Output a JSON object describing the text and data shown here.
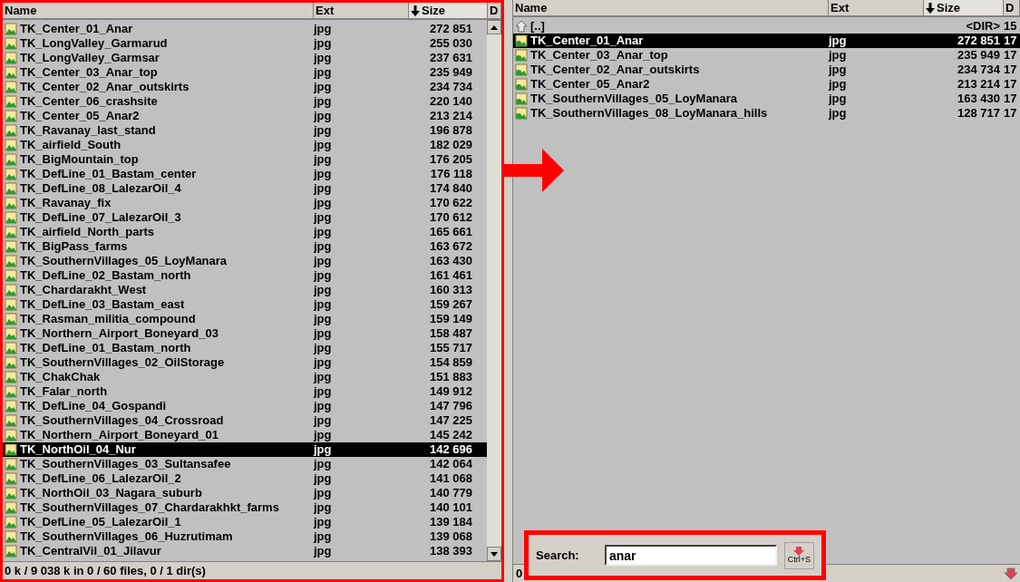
{
  "left_panel": {
    "columns": [
      {
        "label": "Name",
        "sorted": false
      },
      {
        "label": "Ext",
        "sorted": false
      },
      {
        "label": "Size",
        "sorted": true
      },
      {
        "label": "D",
        "sorted": false
      }
    ],
    "rows": [
      {
        "name": "TK_Center_01_Anar",
        "ext": "jpg",
        "size": "272 851",
        "selected": false
      },
      {
        "name": "TK_LongValley_Garmarud",
        "ext": "jpg",
        "size": "255 030",
        "selected": false
      },
      {
        "name": "TK_LongValley_Garmsar",
        "ext": "jpg",
        "size": "237 631",
        "selected": false
      },
      {
        "name": "TK_Center_03_Anar_top",
        "ext": "jpg",
        "size": "235 949",
        "selected": false
      },
      {
        "name": "TK_Center_02_Anar_outskirts",
        "ext": "jpg",
        "size": "234 734",
        "selected": false
      },
      {
        "name": "TK_Center_06_crashsite",
        "ext": "jpg",
        "size": "220 140",
        "selected": false
      },
      {
        "name": "TK_Center_05_Anar2",
        "ext": "jpg",
        "size": "213 214",
        "selected": false
      },
      {
        "name": "TK_Ravanay_last_stand",
        "ext": "jpg",
        "size": "196 878",
        "selected": false
      },
      {
        "name": "TK_airfield_South",
        "ext": "jpg",
        "size": "182 029",
        "selected": false
      },
      {
        "name": "TK_BigMountain_top",
        "ext": "jpg",
        "size": "176 205",
        "selected": false
      },
      {
        "name": "TK_DefLine_01_Bastam_center",
        "ext": "jpg",
        "size": "176 118",
        "selected": false
      },
      {
        "name": "TK_DefLine_08_LalezarOil_4",
        "ext": "jpg",
        "size": "174 840",
        "selected": false
      },
      {
        "name": "TK_Ravanay_fix",
        "ext": "jpg",
        "size": "170 622",
        "selected": false
      },
      {
        "name": "TK_DefLine_07_LalezarOil_3",
        "ext": "jpg",
        "size": "170 612",
        "selected": false
      },
      {
        "name": "TK_airfield_North_parts",
        "ext": "jpg",
        "size": "165 661",
        "selected": false
      },
      {
        "name": "TK_BigPass_farms",
        "ext": "jpg",
        "size": "163 672",
        "selected": false
      },
      {
        "name": "TK_SouthernVillages_05_LoyManara",
        "ext": "jpg",
        "size": "163 430",
        "selected": false
      },
      {
        "name": "TK_DefLine_02_Bastam_north",
        "ext": "jpg",
        "size": "161 461",
        "selected": false
      },
      {
        "name": "TK_Chardarakht_West",
        "ext": "jpg",
        "size": "160 313",
        "selected": false
      },
      {
        "name": "TK_DefLine_03_Bastam_east",
        "ext": "jpg",
        "size": "159 267",
        "selected": false
      },
      {
        "name": "TK_Rasman_militia_compound",
        "ext": "jpg",
        "size": "159 149",
        "selected": false
      },
      {
        "name": "TK_Northern_Airport_Boneyard_03",
        "ext": "jpg",
        "size": "158 487",
        "selected": false
      },
      {
        "name": "TK_DefLine_01_Bastam_north",
        "ext": "jpg",
        "size": "155 717",
        "selected": false
      },
      {
        "name": "TK_SouthernVillages_02_OilStorage",
        "ext": "jpg",
        "size": "154 859",
        "selected": false
      },
      {
        "name": "TK_ChakChak",
        "ext": "jpg",
        "size": "151 883",
        "selected": false
      },
      {
        "name": "TK_Falar_north",
        "ext": "jpg",
        "size": "149 912",
        "selected": false
      },
      {
        "name": "TK_DefLine_04_Gospandi",
        "ext": "jpg",
        "size": "147 796",
        "selected": false
      },
      {
        "name": "TK_SouthernVillages_04_Crossroad",
        "ext": "jpg",
        "size": "147 225",
        "selected": false
      },
      {
        "name": "TK_Northern_Airport_Boneyard_01",
        "ext": "jpg",
        "size": "145 242",
        "selected": false
      },
      {
        "name": "TK_NorthOil_04_Nur",
        "ext": "jpg",
        "size": "142 696",
        "selected": true
      },
      {
        "name": "TK_SouthernVillages_03_Sultansafee",
        "ext": "jpg",
        "size": "142 064",
        "selected": false
      },
      {
        "name": "TK_DefLine_06_LalezarOil_2",
        "ext": "jpg",
        "size": "141 068",
        "selected": false
      },
      {
        "name": "TK_NorthOil_03_Nagara_suburb",
        "ext": "jpg",
        "size": "140 779",
        "selected": false
      },
      {
        "name": "TK_SouthernVillages_07_Chardarakhkt_farms",
        "ext": "jpg",
        "size": "140 101",
        "selected": false
      },
      {
        "name": "TK_DefLine_05_LalezarOil_1",
        "ext": "jpg",
        "size": "139 184",
        "selected": false
      },
      {
        "name": "TK_SouthernVillages_06_Huzrutimam",
        "ext": "jpg",
        "size": "139 068",
        "selected": false
      },
      {
        "name": "TK_CentralVil_01_Jilavur",
        "ext": "jpg",
        "size": "138 393",
        "selected": false
      }
    ],
    "status": "0 k / 9 038 k in 0 / 60 files, 0 / 1 dir(s)"
  },
  "right_panel": {
    "columns": [
      {
        "label": "Name",
        "sorted": false
      },
      {
        "label": "Ext",
        "sorted": false
      },
      {
        "label": "Size",
        "sorted": true
      },
      {
        "label": "D",
        "sorted": false
      }
    ],
    "rows": [
      {
        "kind": "parent",
        "name": "[..]",
        "ext": "",
        "size": "<DIR>",
        "column_4": "15",
        "selected": false
      },
      {
        "kind": "file",
        "name": "TK_Center_01_Anar",
        "ext": "jpg",
        "size": "272 851",
        "column_4": "17",
        "selected": true
      },
      {
        "kind": "file",
        "name": "TK_Center_03_Anar_top",
        "ext": "jpg",
        "size": "235 949",
        "column_4": "17",
        "selected": false
      },
      {
        "kind": "file",
        "name": "TK_Center_02_Anar_outskirts",
        "ext": "jpg",
        "size": "234 734",
        "column_4": "17",
        "selected": false
      },
      {
        "kind": "file",
        "name": "TK_Center_05_Anar2",
        "ext": "jpg",
        "size": "213 214",
        "column_4": "17",
        "selected": false
      },
      {
        "kind": "file",
        "name": "TK_SouthernVillages_05_LoyManara",
        "ext": "jpg",
        "size": "163 430",
        "column_4": "17",
        "selected": false
      },
      {
        "kind": "file",
        "name": "TK_SouthernVillages_08_LoyManara_hills",
        "ext": "jpg",
        "size": "128 717",
        "column_4": "17",
        "selected": false
      }
    ],
    "status": "0"
  },
  "search": {
    "label": "Search:",
    "value": "anar",
    "button_hint": "Ctrl+S"
  }
}
